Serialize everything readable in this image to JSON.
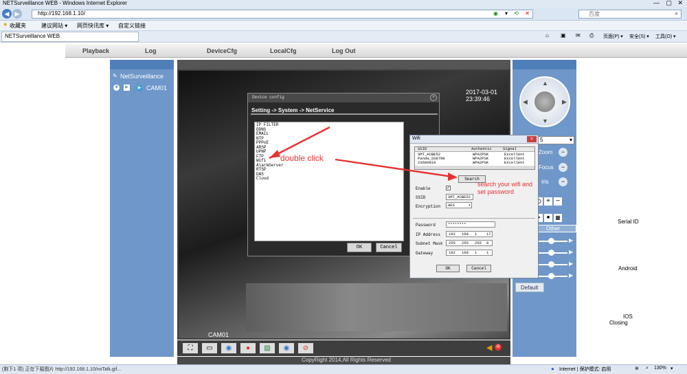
{
  "browser": {
    "window_title": "NETSurveillance WEB - Windows Internet Explorer",
    "url": "http://192.168.1.10/",
    "search_placeholder": "百度",
    "favorites_label": "收藏夹",
    "fav_links": [
      "建议网站 ▾",
      "网页快讯库 ▾",
      "自定义链接"
    ],
    "tab_label": "NETSurveillance WEB",
    "cmd_items": [
      "页面(P) ▾",
      "安全(S) ▾",
      "工具(O) ▾"
    ]
  },
  "menu": {
    "items": [
      "Playback",
      "Log",
      "DeviceCfg",
      "LocalCfg",
      "Log Out"
    ]
  },
  "left_panel": {
    "device_name": "NetSurveillance",
    "channel": "CAM01"
  },
  "video": {
    "timestamp": "2017-03-01 23:39:46",
    "channel_label": "CAM01"
  },
  "service_dialog": {
    "title": "Device config",
    "breadcrumb": "Setting -> System -> NetService",
    "services": [
      "IP FILTER",
      "DDNS",
      "EMAIL",
      "NTP",
      "PPPoE",
      "ARSP",
      "UPNP",
      "FTP",
      "Wifi",
      "AlarmServer",
      "RTSP",
      "DAS",
      "Cloud"
    ],
    "ok": "OK",
    "cancel": "Cancel"
  },
  "wifi_dialog": {
    "title": "Wifi",
    "columns": [
      "SSID",
      "Authentic",
      "Signal"
    ],
    "networks": [
      {
        "ssid": "SMT_ACBE52",
        "auth": "WPA2PSK",
        "signal": "Excellent"
      },
      {
        "ssid": "Panda_SS8798",
        "auth": "WPA2PSK",
        "signal": "Excellent"
      },
      {
        "ssid": "23680810",
        "auth": "WPA2PSK",
        "signal": "Excellent"
      }
    ],
    "search": "Search",
    "enable_label": "Enable",
    "ssid_label": "SSID",
    "ssid_value": "SMT_ACBE52",
    "encryption_label": "Encryption",
    "encryption_value": "AES",
    "password_label": "Password",
    "password_value": "********",
    "ip_label": "IP Address",
    "ip_value": [
      "192",
      "168",
      "1",
      "17"
    ],
    "mask_label": "Subnet Mask",
    "mask_value": [
      "255",
      "255",
      "255",
      "0"
    ],
    "gateway_label": "Gateway",
    "gateway_value": [
      "192",
      "168",
      "1",
      "1"
    ],
    "ok": "OK",
    "cancel": "Cancel"
  },
  "annotations": {
    "double_click": "double click",
    "search_hint": "search your wifi and\nset password"
  },
  "ptz": {
    "speed_value": "5",
    "zoom": "Zoom",
    "focus": "Focus",
    "iris": "Iris",
    "other_tab": "Other",
    "default_btn": "Default"
  },
  "right_side": {
    "serial": "Serial ID",
    "android": "Android",
    "ios": "IOS",
    "closing": "Closing"
  },
  "footer": {
    "copyright": "CopyRight 2014,All Rights Reserved"
  },
  "status": {
    "left": "(剩下1 项) 正在下载图片 http://192.168.1.10/noTalk.gif...",
    "zone": "Internet | 保护模式: 启用",
    "zoom": "130%"
  },
  "colors": {
    "panel_blue": "#6f97c9",
    "accent_red": "#e8312f"
  }
}
